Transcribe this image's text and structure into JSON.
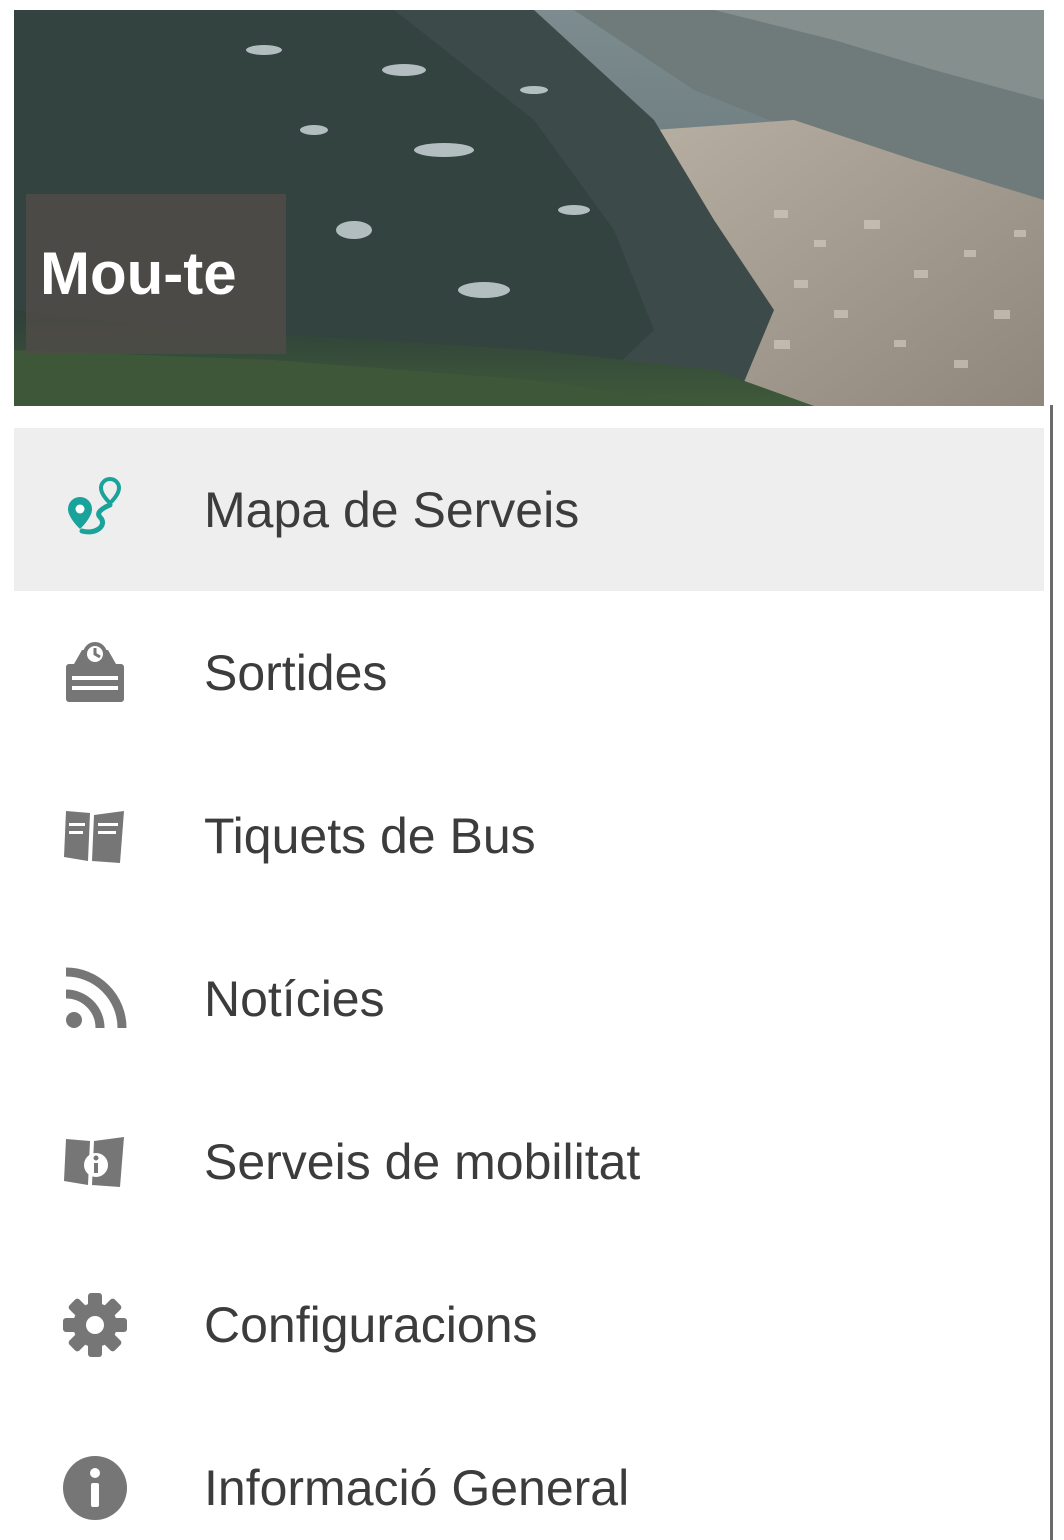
{
  "header": {
    "title": "Mou-te"
  },
  "colors": {
    "accent": "#1aa39a",
    "icon_gray": "#767676",
    "active_bg": "#eeeeee",
    "text": "#3c3c3c"
  },
  "menu": {
    "items": [
      {
        "label": "Mapa de Serveis",
        "icon": "route-map-icon",
        "active": true
      },
      {
        "label": "Sortides",
        "icon": "departures-schedule-icon",
        "active": false
      },
      {
        "label": "Tiquets de Bus",
        "icon": "bus-tickets-icon",
        "active": false
      },
      {
        "label": "Notícies",
        "icon": "rss-feed-icon",
        "active": false
      },
      {
        "label": "Serveis de mobilitat",
        "icon": "mobility-services-icon",
        "active": false
      },
      {
        "label": "Configuracions",
        "icon": "gear-icon",
        "active": false
      },
      {
        "label": "Informació General",
        "icon": "info-icon",
        "active": false
      }
    ]
  }
}
